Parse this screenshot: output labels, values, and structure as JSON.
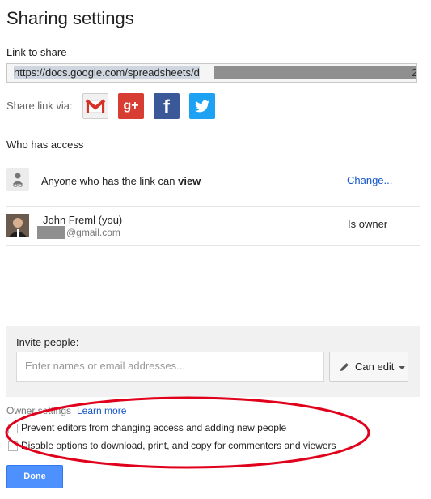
{
  "dialog": {
    "title": "Sharing settings"
  },
  "link": {
    "label": "Link to share",
    "url": "https://docs.google.com/spreadsheets/d",
    "url_end": "2"
  },
  "share_via": {
    "label": "Share link via:",
    "gplus_text": "g+",
    "facebook_text": "f"
  },
  "access": {
    "header": "Who has access",
    "anyone_text": "Anyone who has the link can ",
    "anyone_bold": "view",
    "change_link": "Change...",
    "owner_name": "John Freml (you)",
    "owner_email_suffix": "@gmail.com",
    "owner_role": "Is owner"
  },
  "invite": {
    "label": "Invite people:",
    "placeholder": "Enter names or email addresses...",
    "permission": "Can edit"
  },
  "owner_settings": {
    "label": "Owner settings",
    "learn_more": "Learn more",
    "option1": "Prevent editors from changing access and adding new people",
    "option2": "Disable options to download, print, and copy for commenters and viewers"
  },
  "footer": {
    "done_label": "Done"
  },
  "colors": {
    "accent": "#4d90fe",
    "link": "#1155cc",
    "highlight_ellipse": "#e0001b"
  }
}
